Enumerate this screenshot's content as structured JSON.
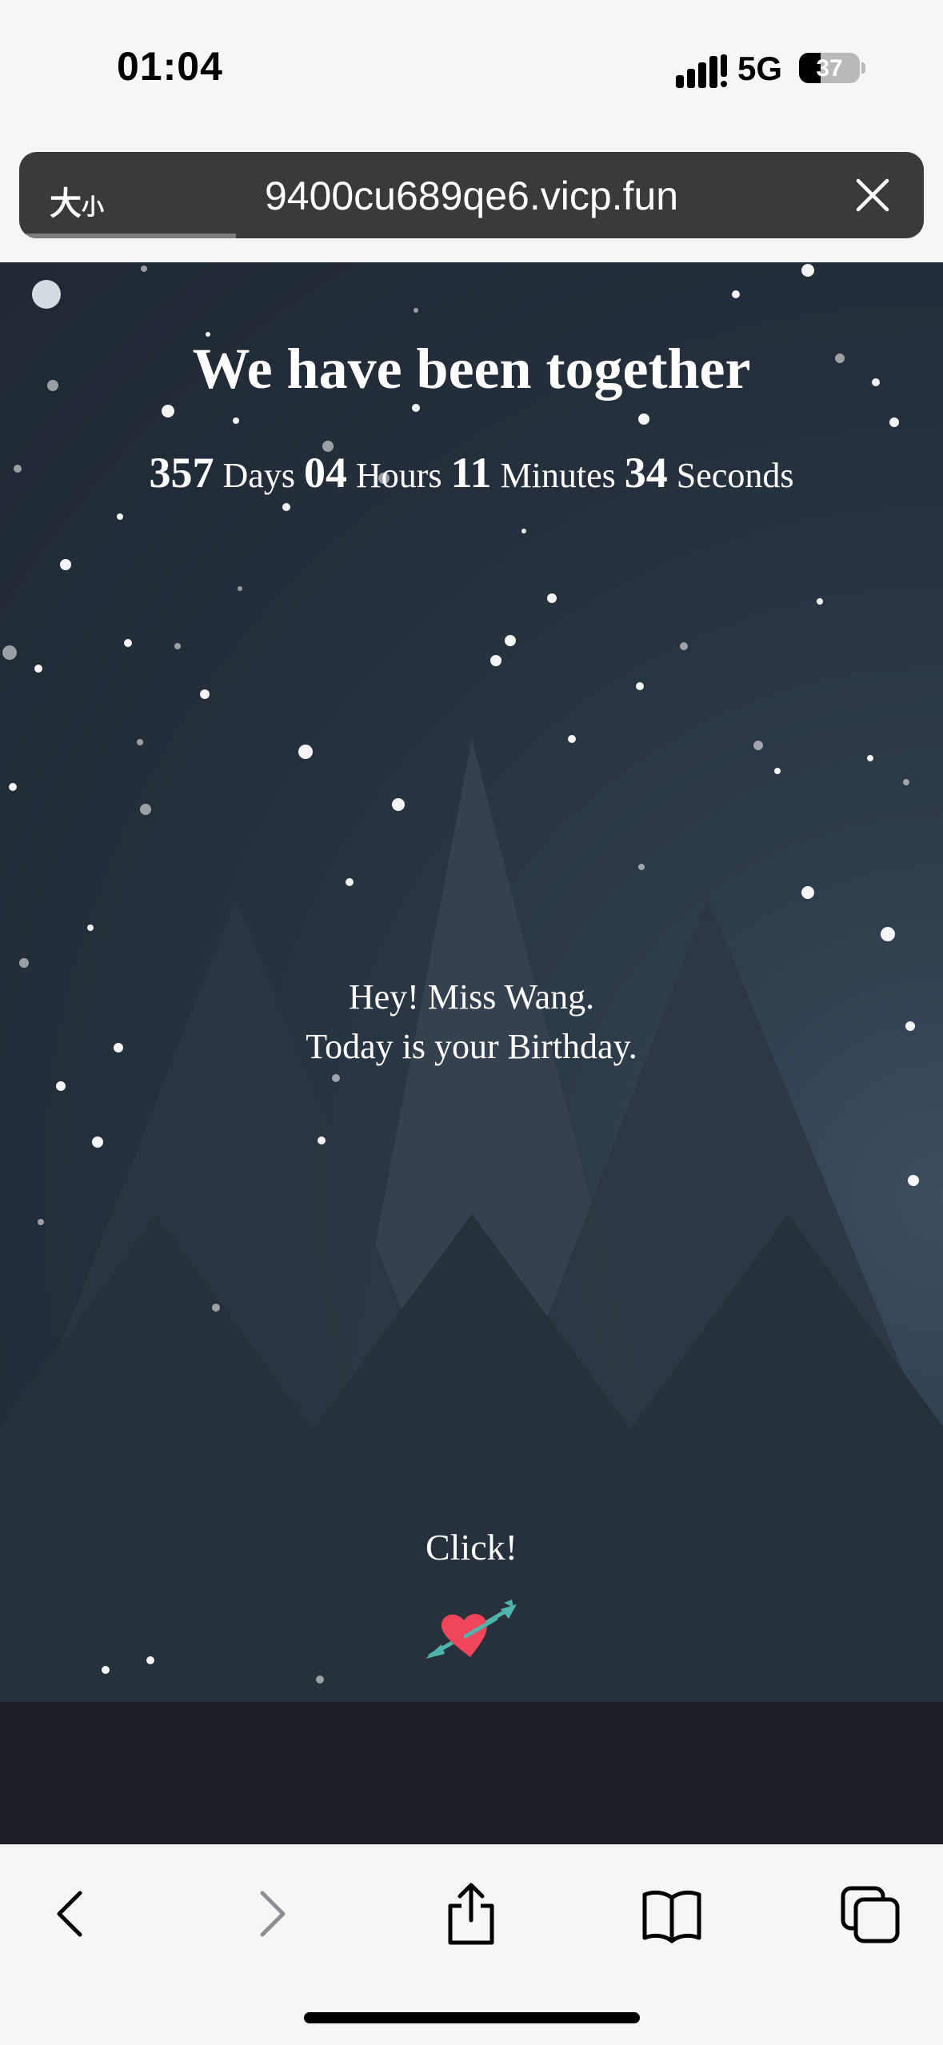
{
  "status_bar": {
    "time": "01:04",
    "network": "5G",
    "battery": "37"
  },
  "url_bar": {
    "font_button": "大",
    "font_button_small": "小",
    "url": "9400cu689qe6.vicp.fun"
  },
  "page": {
    "title": "We have been together",
    "counter": {
      "days": "357",
      "days_label": "Days",
      "hours": "04",
      "hours_label": "Hours",
      "minutes": "11",
      "minutes_label": "Minutes",
      "seconds": "34",
      "seconds_label": "Seconds"
    },
    "message_line1": "Hey! Miss Wang.",
    "message_line2": "Today is your Birthday.",
    "click_label": "Click!"
  },
  "toolbar": {
    "back": "back-icon",
    "forward": "forward-icon",
    "share": "share-icon",
    "bookmarks": "book-icon",
    "tabs": "tabs-icon"
  }
}
